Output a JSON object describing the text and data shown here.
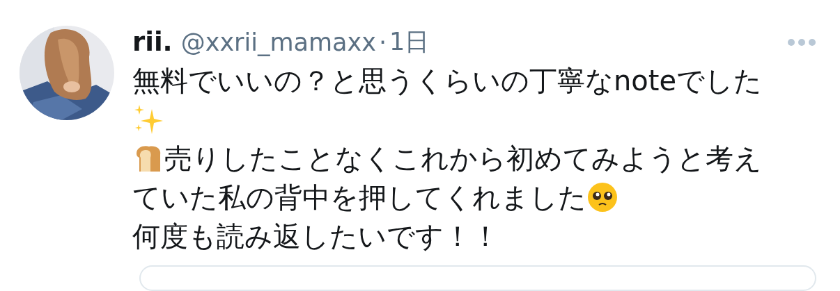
{
  "tweet": {
    "name": "rii.",
    "handle": "@xxrii_mamaxx",
    "separator": "·",
    "time": "1日",
    "avatar": {
      "kind": "picture"
    },
    "lines": [
      [
        {
          "kind": "text",
          "text": "無料でいいの？と思うくらいの丁寧なnoteでした"
        }
      ],
      [
        {
          "kind": "sparkles"
        }
      ],
      [
        {
          "kind": "bread"
        },
        {
          "kind": "text",
          "text": "売りしたことなくこれから初めてみようと考え"
        }
      ],
      [
        {
          "kind": "text",
          "text": "ていた私の背中を押してくれました"
        },
        {
          "kind": "pleading"
        }
      ],
      [
        {
          "kind": "text",
          "text": "何度も読み返したいです！！"
        }
      ]
    ],
    "quoted_card": {
      "kind": "card"
    }
  }
}
